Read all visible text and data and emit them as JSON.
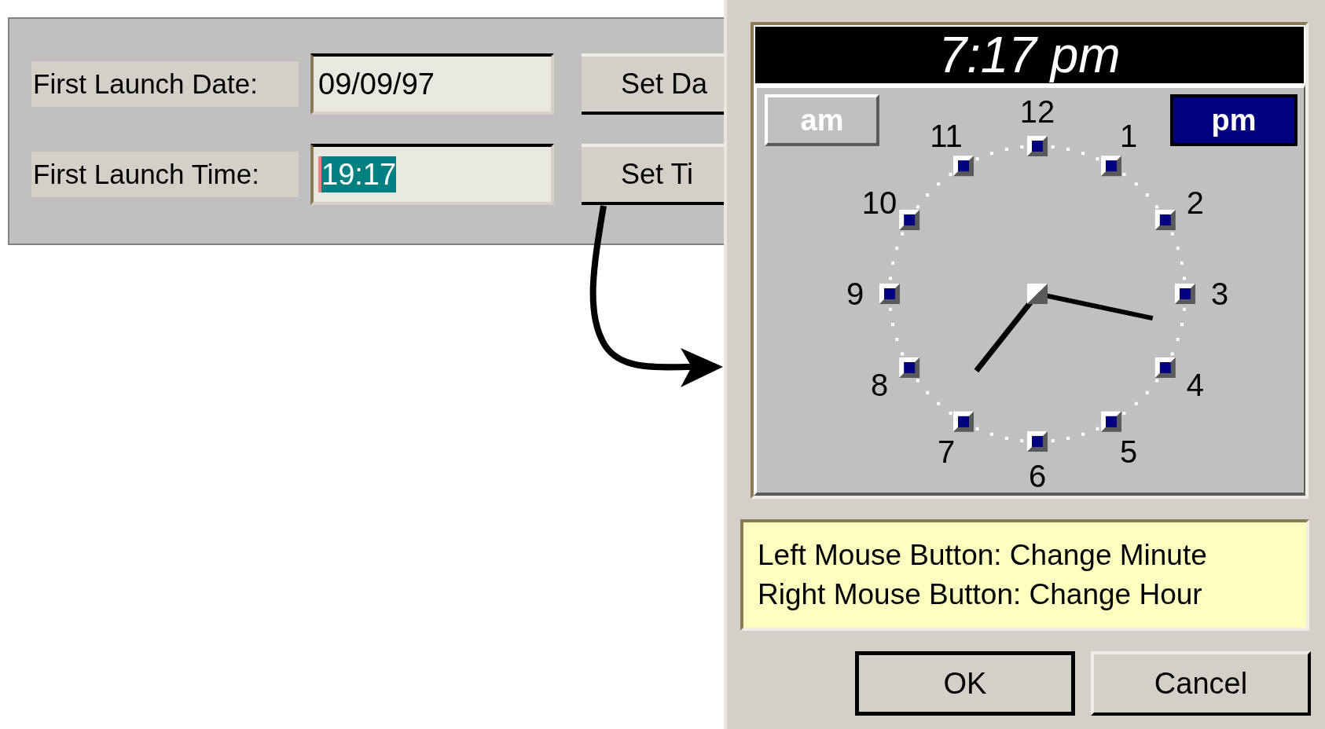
{
  "panel": {
    "rows": [
      {
        "label": "First Launch Date:",
        "value": "09/09/97",
        "value_selected": false,
        "button": "Set Da"
      },
      {
        "label": "First Launch Time:",
        "value": "19:17",
        "value_selected": true,
        "button": "Set Ti"
      }
    ]
  },
  "time_dialog": {
    "display": "7:17 pm",
    "periods": [
      {
        "label": "am",
        "selected": false
      },
      {
        "label": "pm",
        "selected": true
      }
    ],
    "hour_labels": [
      "12",
      "1",
      "2",
      "3",
      "4",
      "5",
      "6",
      "7",
      "8",
      "9",
      "10",
      "11"
    ],
    "hints": [
      "Left Mouse Button: Change Minute",
      "Right Mouse Button: Change Hour"
    ],
    "buttons": [
      {
        "label": "OK",
        "default": true
      },
      {
        "label": "Cancel",
        "default": false
      }
    ]
  }
}
